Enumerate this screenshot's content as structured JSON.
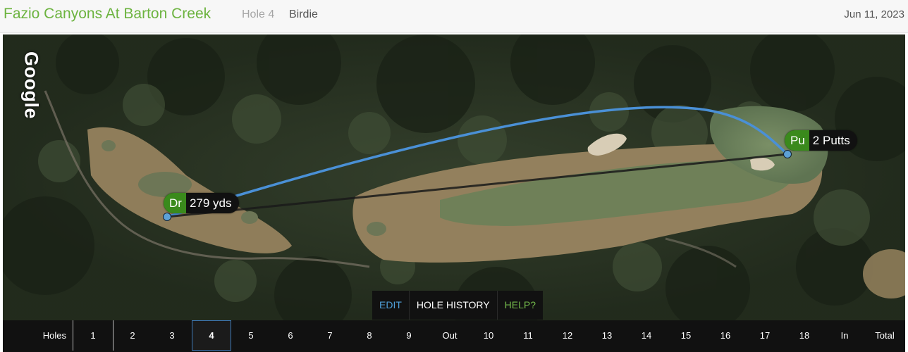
{
  "header": {
    "course_name": "Fazio Canyons At Barton Creek",
    "hole_label": "Hole 4",
    "result": "Birdie",
    "date": "Jun 11, 2023"
  },
  "map": {
    "provider_logo": "Google",
    "shots": [
      {
        "club": "Dr",
        "detail": "279 yds"
      },
      {
        "club": "Pu",
        "detail": "2 Putts"
      }
    ],
    "colors": {
      "shot_arc": "#4a90d6",
      "shot_line": "#1a1a1a",
      "club_badge": "#3a8a1c",
      "map_background": "#2b3326"
    }
  },
  "map_buttons": {
    "edit": "EDIT",
    "hole_history": "HOLE HISTORY",
    "help": "HELP?"
  },
  "scorebar": {
    "label": "Holes",
    "active_hole": "4",
    "front": [
      "1",
      "2",
      "3",
      "4",
      "5",
      "6",
      "7",
      "8",
      "9"
    ],
    "out": "Out",
    "back": [
      "10",
      "11",
      "12",
      "13",
      "14",
      "15",
      "16",
      "17",
      "18"
    ],
    "in": "In",
    "total": "Total"
  }
}
